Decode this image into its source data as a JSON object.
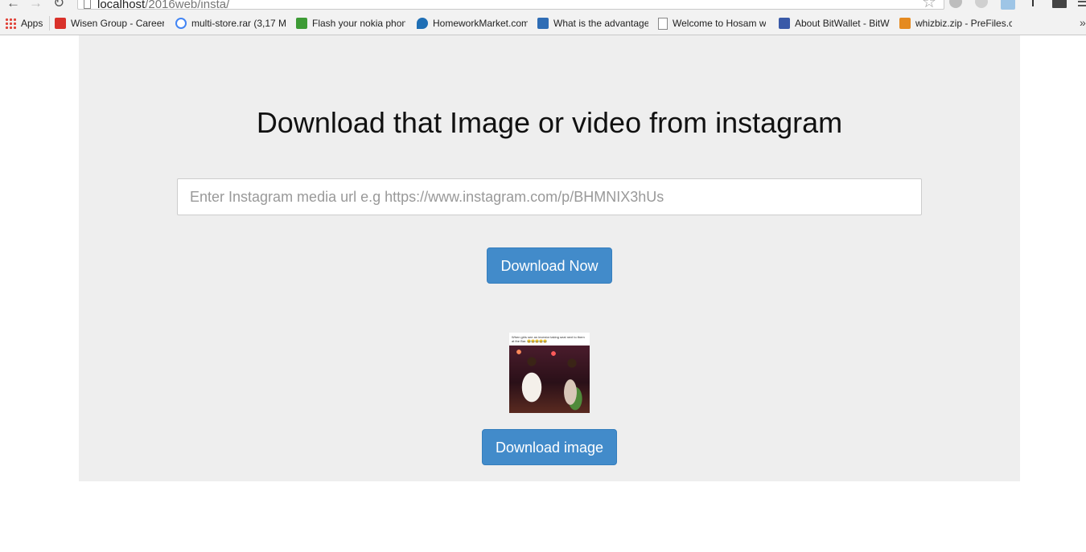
{
  "browser": {
    "url_host": "localhost",
    "url_path": "/2016web/insta/",
    "bookmarks": [
      {
        "label": "Apps",
        "icon": "apps-grid-icon",
        "color": "#e0433a"
      },
      {
        "label": "Wisen Group - Career",
        "icon": "z-logo-icon",
        "color": "#d9312a"
      },
      {
        "label": "multi-store.rar (3,17 M",
        "icon": "google-icon",
        "color": "#4285f4"
      },
      {
        "label": "Flash your nokia phon",
        "icon": "download-arrow-icon",
        "color": "#3d9b35"
      },
      {
        "label": "HomeworkMarket.com",
        "icon": "drop-icon",
        "color": "#1f6fb5"
      },
      {
        "label": "What is the advantage",
        "icon": "ask-logo-icon",
        "color": "#2f6db5"
      },
      {
        "label": "Welcome to Hosam w",
        "icon": "page-icon",
        "color": "#888888"
      },
      {
        "label": "About BitWallet - BitW",
        "icon": "bitwallet-icon",
        "color": "#3a5aa8"
      },
      {
        "label": "whizbiz.zip - PreFiles.c",
        "icon": "prefiles-icon",
        "color": "#e58a1f"
      }
    ]
  },
  "page": {
    "heading": "Download that Image or video from instagram",
    "input_placeholder": "Enter Instagram media url e.g https://www.instagram.com/p/BHMNIX3hUs",
    "download_now_label": "Download Now",
    "download_image_label": "Download image",
    "thumbnail_caption": "When girls see an investor taking seat next to them at the Bar. 😂😂😂😂😂"
  },
  "colors": {
    "panel_bg": "#eeeeee",
    "button_primary": "#428bca"
  }
}
